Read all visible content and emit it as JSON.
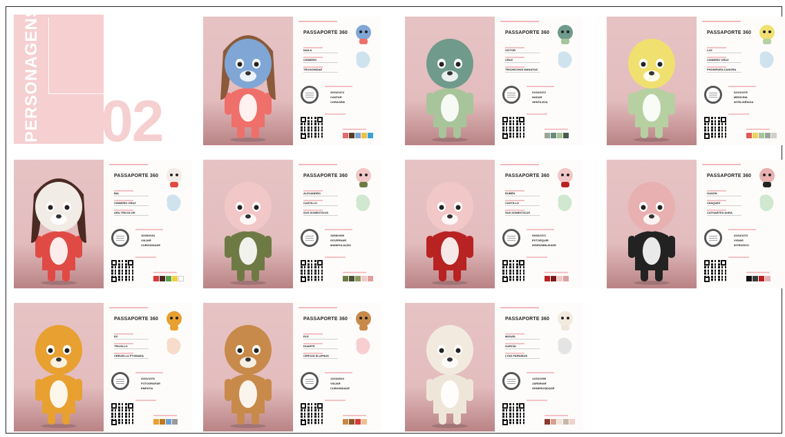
{
  "title": {
    "vertical": "PERSONAGENS",
    "number": "02"
  },
  "pass_title": "PASSAPORTE 360",
  "cards": [
    {
      "name": "NAILA",
      "surname": "CISNEIRO",
      "species": "TROGONIDAE",
      "date": "20/04/1974",
      "job": "CANTAR",
      "trait": "CORAGEM",
      "body": "#ef6f6a",
      "head": "#7fa6d4",
      "hair": "#8a5a3a",
      "colors": [
        "#e46c6a",
        "#5b3a2a",
        "#7fa6d4",
        "#f0c040",
        "#3aa0d8"
      ],
      "map": "#cfe3ee"
    },
    {
      "name": "VICTOR",
      "surname": "CRUZ",
      "species": "TRICHECHUS MANATUS",
      "date": "01/04/1972",
      "job": "NADAR",
      "trait": "GENTILEZA",
      "body": "#a8c49a",
      "head": "#6f9a8c",
      "hair": "",
      "colors": [
        "#9aa59a",
        "#6a8a7a",
        "#a8c49a",
        "#4a5a50"
      ],
      "map": "#cfe3ee"
    },
    {
      "name": "LUZ",
      "surname": "CISNEIRO CRUZ",
      "species": "PHONIPARA CANORA",
      "date": "02/10/1976",
      "job": "MEDICINA",
      "trait": "INTELIGÊNCIA",
      "body": "#b6d0a2",
      "head": "#f0e070",
      "hair": "",
      "colors": [
        "#e05a50",
        "#f0d060",
        "#a8c49a",
        "#9aa59a",
        "#cfd0c8"
      ],
      "map": "#cfe3ee"
    },
    {
      "name": "BIA",
      "surname": "CISNEIRO CRUZ",
      "species": "ARA TRICOLOR",
      "date": "10/08/2004",
      "job": "VIAJAR",
      "trait": "CURIOSIDADE",
      "body": "#e04a44",
      "head": "#f2ece6",
      "hair": "#4a2a22",
      "colors": [
        "#d83a3a",
        "#4a2a22",
        "#5aa04a",
        "#f0d040",
        "#ffffff"
      ],
      "map": "#cfe3ee"
    },
    {
      "name": "ALEJANDRO",
      "surname": "CASTILLO",
      "species": "SUS DOMESTICUS",
      "date": "15/08/1969",
      "job": "GOVERNAR",
      "trait": "MANIPULAÇÃO",
      "body": "#6e7a44",
      "head": "#f2c7c8",
      "hair": "",
      "colors": [
        "#6e7a44",
        "#4a5430",
        "#8a9a5a",
        "#f2c7c8",
        "#e0a0a0"
      ],
      "map": "#cfe8cf"
    },
    {
      "name": "RUBÉN",
      "surname": "CASTILLO",
      "species": "SUS DOMESTICUS",
      "date": "05/06/1972",
      "job": "EXTORQUIR",
      "trait": "INSENSIBILIDADE",
      "body": "#b82222",
      "head": "#f2c7c8",
      "hair": "",
      "colors": [
        "#b82222",
        "#7a1a1a",
        "#f2c7c8",
        "#e0a0a0"
      ],
      "map": "#cfe8cf"
    },
    {
      "name": "GASÓN",
      "surname": "VÁSQUEZ",
      "species": "CATHARTES AURA",
      "date": "02/04/1973",
      "job": "VIGIAR",
      "trait": "INTRUSIVO",
      "body": "#222222",
      "head": "#e8b0b0",
      "hair": "",
      "colors": [
        "#111111",
        "#3a3a3a",
        "#b82222",
        "#e8b0b0"
      ],
      "map": "#cfe8cf"
    },
    {
      "name": "IDÍ",
      "surname": "TRUJILLO",
      "species": "CEBUELLA PYGMAEA",
      "date": "20/01/1976",
      "job": "FOTOGRAFAR",
      "trait": "EMPATIA",
      "body": "#e8a030",
      "head": "#e8a030",
      "hair": "",
      "colors": [
        "#e8a030",
        "#c07820",
        "#6aa0d0",
        "#9a9a9a"
      ],
      "map": "#f7dccb"
    },
    {
      "name": "ELE",
      "surname": "DUARTE",
      "species": "CERVUS ELAPHUS",
      "date": "11/03/2004",
      "job": "VIAJAR",
      "trait": "CURIOSIDADE",
      "body": "#c88a4a",
      "head": "#c88a4a",
      "hair": "",
      "colors": [
        "#c88a4a",
        "#8a5a2a",
        "#d83a3a",
        "#f0c090"
      ],
      "map": "#f7cfd0"
    },
    {
      "name": "MIGUEL",
      "surname": "GARCÍA",
      "species": "LYNX PARDINUS",
      "date": "12/02/1995",
      "job": "JARDINAR",
      "trait": "GENEROSIDADE",
      "body": "#efe6da",
      "head": "#f2eadf",
      "hair": "",
      "colors": [
        "#8a3a2a",
        "#d8a090",
        "#efe6da",
        "#c8b8a8",
        "#f0d0c8"
      ],
      "map": "#e4e4e4"
    }
  ]
}
